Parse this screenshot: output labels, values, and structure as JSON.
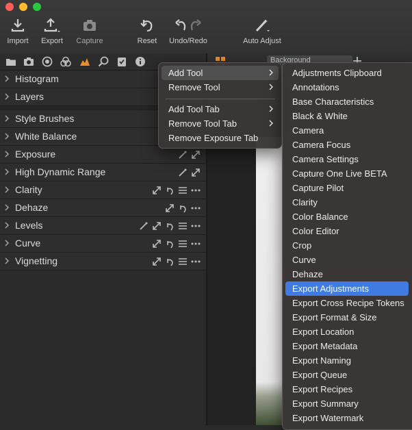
{
  "toolbar": {
    "buttons": [
      {
        "label": "Import",
        "icon": "import-icon"
      },
      {
        "label": "Export",
        "icon": "export-icon"
      },
      {
        "label": "Capture",
        "icon": "camera-icon"
      },
      {
        "label": "Reset",
        "icon": "reset-icon"
      },
      {
        "label": "Undo/Redo",
        "icon": "undo-redo-icon"
      },
      {
        "label": "Auto Adjust",
        "icon": "magic-wand-icon"
      }
    ]
  },
  "tabs": [
    "library-tab",
    "capture-tab",
    "lens-tab",
    "color-tab",
    "exposure-tab",
    "details-tab",
    "adjustments-tab",
    "metadata-tab"
  ],
  "tools": {
    "items": [
      {
        "label": "Histogram"
      },
      {
        "label": "Layers"
      },
      {
        "label": "Style Brushes"
      },
      {
        "label": "White Balance"
      },
      {
        "label": "Exposure"
      },
      {
        "label": "High Dynamic Range"
      },
      {
        "label": "Clarity"
      },
      {
        "label": "Dehaze"
      },
      {
        "label": "Levels"
      },
      {
        "label": "Curve"
      },
      {
        "label": "Vignetting"
      }
    ]
  },
  "viewer": {
    "background_select": "Background"
  },
  "context_menu": {
    "items": [
      {
        "label": "Add Tool",
        "has_submenu": true
      },
      {
        "label": "Remove Tool",
        "has_submenu": true
      },
      {
        "label": "Add Tool Tab",
        "has_submenu": true
      },
      {
        "label": "Remove Tool Tab",
        "has_submenu": true
      },
      {
        "label": "Remove Exposure Tab",
        "has_submenu": false
      }
    ]
  },
  "submenu": {
    "selected": "Export Adjustments",
    "items": [
      "Adjustments Clipboard",
      "Annotations",
      "Base Characteristics",
      "Black & White",
      "Camera",
      "Camera Focus",
      "Camera Settings",
      "Capture One Live BETA",
      "Capture Pilot",
      "Clarity",
      "Color Balance",
      "Color Editor",
      "Crop",
      "Curve",
      "Dehaze",
      "Export Adjustments",
      "Export Cross Recipe Tokens",
      "Export Format & Size",
      "Export Location",
      "Export Metadata",
      "Export Naming",
      "Export Queue",
      "Export Recipes",
      "Export Summary",
      "Export Watermark"
    ]
  },
  "colors": {
    "accent": "#e8902a",
    "selection": "#3f7be0"
  }
}
